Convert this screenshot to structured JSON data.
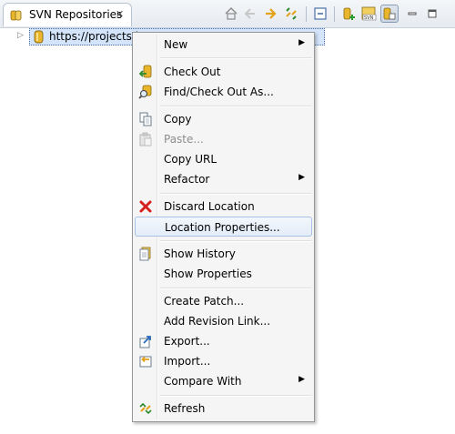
{
  "view": {
    "tab_title": "SVN Repositories",
    "tab_close": "✕",
    "tab_icon": "svn-repository-icon"
  },
  "toolbar": {
    "buttons": [
      {
        "name": "home-icon",
        "enabled": true
      },
      {
        "name": "back-icon",
        "enabled": false
      },
      {
        "name": "forward-icon",
        "enabled": true
      },
      {
        "name": "link-with-editor-icon",
        "enabled": true
      },
      {
        "name": "collapse-all-icon",
        "enabled": true
      },
      {
        "name": "new-repository-location-icon",
        "enabled": true
      },
      {
        "name": "import-svn-icon",
        "enabled": true
      },
      {
        "name": "show-repository-browser-icon",
        "enabled": true,
        "pressed": true
      },
      {
        "name": "minimize-icon",
        "enabled": true
      },
      {
        "name": "maximize-icon",
        "enabled": true
      }
    ]
  },
  "tree": {
    "node_label": "https://projects.it",
    "expand_glyph": "▷"
  },
  "context_menu": {
    "submenu_glyph": "▶",
    "items": [
      {
        "label": "New",
        "icon": "",
        "submenu": true
      },
      {
        "label": "Check Out",
        "icon": "checkout-icon"
      },
      {
        "label": "Find/Check Out As...",
        "icon": "find-checkout-icon"
      },
      {
        "label": "Copy",
        "icon": "copy-icon"
      },
      {
        "label": "Paste...",
        "icon": "paste-icon",
        "disabled": true
      },
      {
        "label": "Copy URL",
        "icon": ""
      },
      {
        "label": "Refactor",
        "icon": "",
        "submenu": true
      },
      {
        "label": "Discard Location",
        "icon": "discard-icon"
      },
      {
        "label": "Location Properties...",
        "icon": "",
        "highlighted": true
      },
      {
        "label": "Show History",
        "icon": "history-icon"
      },
      {
        "label": "Show Properties",
        "icon": ""
      },
      {
        "label": "Create Patch...",
        "icon": ""
      },
      {
        "label": "Add Revision Link...",
        "icon": ""
      },
      {
        "label": "Export...",
        "icon": "export-icon"
      },
      {
        "label": "Import...",
        "icon": "import-icon"
      },
      {
        "label": "Compare With",
        "icon": "",
        "submenu": true
      },
      {
        "label": "Refresh",
        "icon": "refresh-icon"
      }
    ]
  },
  "colors": {
    "selection": "#d4e4fa",
    "menu_bg": "#f5f5f5",
    "hover_border": "#a9c1e3",
    "discard_red": "#d62020",
    "repo_yellow": "#e8b52c"
  }
}
